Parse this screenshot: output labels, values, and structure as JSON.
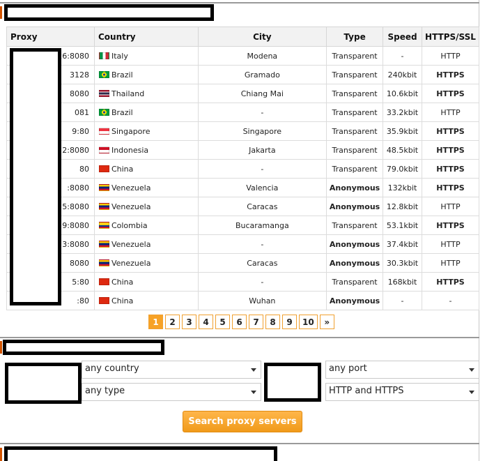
{
  "table": {
    "headers": [
      "Proxy",
      "Country",
      "City",
      "Type",
      "Speed",
      "HTTPS/SSL"
    ],
    "rows": [
      {
        "proxy": "26:8080",
        "country": "Italy",
        "flag": "italy-flag-icon",
        "city": "Modena",
        "type": "Transparent",
        "speed": "-",
        "ssl": "HTTP"
      },
      {
        "proxy": "3128",
        "country": "Brazil",
        "flag": "brazil-flag-icon",
        "city": "Gramado",
        "type": "Transparent",
        "speed": "240kbit",
        "ssl": "HTTPS"
      },
      {
        "proxy": "8080",
        "country": "Thailand",
        "flag": "thailand-flag-icon",
        "city": "Chiang Mai",
        "type": "Transparent",
        "speed": "10.6kbit",
        "ssl": "HTTPS"
      },
      {
        "proxy": "081",
        "country": "Brazil",
        "flag": "brazil-flag-icon",
        "city": "-",
        "type": "Transparent",
        "speed": "33.2kbit",
        "ssl": "HTTP"
      },
      {
        "proxy": "9:80",
        "country": "Singapore",
        "flag": "singapore-flag-icon",
        "city": "Singapore",
        "type": "Transparent",
        "speed": "35.9kbit",
        "ssl": "HTTPS"
      },
      {
        "proxy": "2:8080",
        "country": "Indonesia",
        "flag": "indonesia-flag-icon",
        "city": "Jakarta",
        "type": "Transparent",
        "speed": "48.5kbit",
        "ssl": "HTTPS"
      },
      {
        "proxy": "80",
        "country": "China",
        "flag": "china-flag-icon",
        "city": "-",
        "type": "Transparent",
        "speed": "79.0kbit",
        "ssl": "HTTPS"
      },
      {
        "proxy": ":8080",
        "country": "Venezuela",
        "flag": "venezuela-flag-icon",
        "city": "Valencia",
        "type": "Anonymous",
        "speed": "132kbit",
        "ssl": "HTTPS"
      },
      {
        "proxy": "5:8080",
        "country": "Venezuela",
        "flag": "venezuela-flag-icon",
        "city": "Caracas",
        "type": "Anonymous",
        "speed": "12.8kbit",
        "ssl": "HTTP"
      },
      {
        "proxy": "9:8080",
        "country": "Colombia",
        "flag": "colombia-flag-icon",
        "city": "Bucaramanga",
        "type": "Transparent",
        "speed": "53.1kbit",
        "ssl": "HTTPS"
      },
      {
        "proxy": "3:8080",
        "country": "Venezuela",
        "flag": "venezuela-flag-icon",
        "city": "-",
        "type": "Anonymous",
        "speed": "37.4kbit",
        "ssl": "HTTP"
      },
      {
        "proxy": "8080",
        "country": "Venezuela",
        "flag": "venezuela-flag-icon",
        "city": "Caracas",
        "type": "Anonymous",
        "speed": "30.3kbit",
        "ssl": "HTTP"
      },
      {
        "proxy": "5:80",
        "country": "China",
        "flag": "china-flag-icon",
        "city": "-",
        "type": "Transparent",
        "speed": "168kbit",
        "ssl": "HTTPS"
      },
      {
        "proxy": ":80",
        "country": "China",
        "flag": "china-flag-icon",
        "city": "Wuhan",
        "type": "Anonymous",
        "speed": "-",
        "ssl": "-"
      }
    ]
  },
  "pagination": {
    "pages": [
      "1",
      "2",
      "3",
      "4",
      "5",
      "6",
      "7",
      "8",
      "9",
      "10"
    ],
    "active": "1",
    "next": "»"
  },
  "search": {
    "country_select": "any country",
    "type_select": "any type",
    "port_select": "any port",
    "protocol_select": "HTTP and HTTPS",
    "button": "Search proxy servers"
  },
  "colors": {
    "accent": "#f7a226",
    "section-marker": "#d35400"
  }
}
